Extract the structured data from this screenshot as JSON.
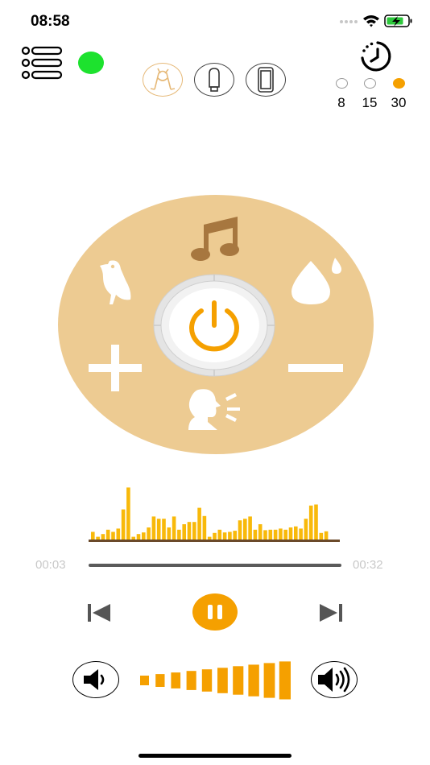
{
  "status_bar": {
    "time": "08:58",
    "battery_charging": true
  },
  "colors": {
    "accent": "#f5a000",
    "wheel": "#edcb92",
    "brown": "#a7773f",
    "connected": "#1de22e",
    "wave": "#f8b90a",
    "track": "#5a5a5a"
  },
  "header": {
    "connection_status": "connected",
    "modes": [
      {
        "name": "hand-massager",
        "icon": "massager-icon",
        "selected": true
      },
      {
        "name": "insert-device",
        "icon": "capsule-icon",
        "selected": false
      },
      {
        "name": "phone-device",
        "icon": "phone-icon",
        "selected": false
      }
    ]
  },
  "timer": {
    "icon": "timer-icon",
    "options": [
      {
        "label": "8",
        "selected": false
      },
      {
        "label": "15",
        "selected": false
      },
      {
        "label": "30",
        "selected": true
      }
    ]
  },
  "wheel": {
    "icons": [
      "music-note-icon",
      "bird-icon",
      "water-drop-icon",
      "plus-icon",
      "minus-icon",
      "voice-icon",
      "power-icon"
    ]
  },
  "player": {
    "elapsed": "00:03",
    "total": "00:32",
    "progress": 0.094,
    "state": "playing",
    "waveform_levels": [
      0.14,
      0.05,
      0.1,
      0.18,
      0.14,
      0.2,
      0.55,
      0.95,
      0.05,
      0.1,
      0.13,
      0.22,
      0.42,
      0.38,
      0.38,
      0.22,
      0.42,
      0.18,
      0.28,
      0.32,
      0.32,
      0.58,
      0.43,
      0.05,
      0.12,
      0.18,
      0.13,
      0.14,
      0.16,
      0.35,
      0.38,
      0.42,
      0.18,
      0.28,
      0.17,
      0.18,
      0.18,
      0.2,
      0.18,
      0.22,
      0.24,
      0.2,
      0.38,
      0.62,
      0.64,
      0.12,
      0.15
    ]
  },
  "volume": {
    "level": 10,
    "max": 10
  }
}
